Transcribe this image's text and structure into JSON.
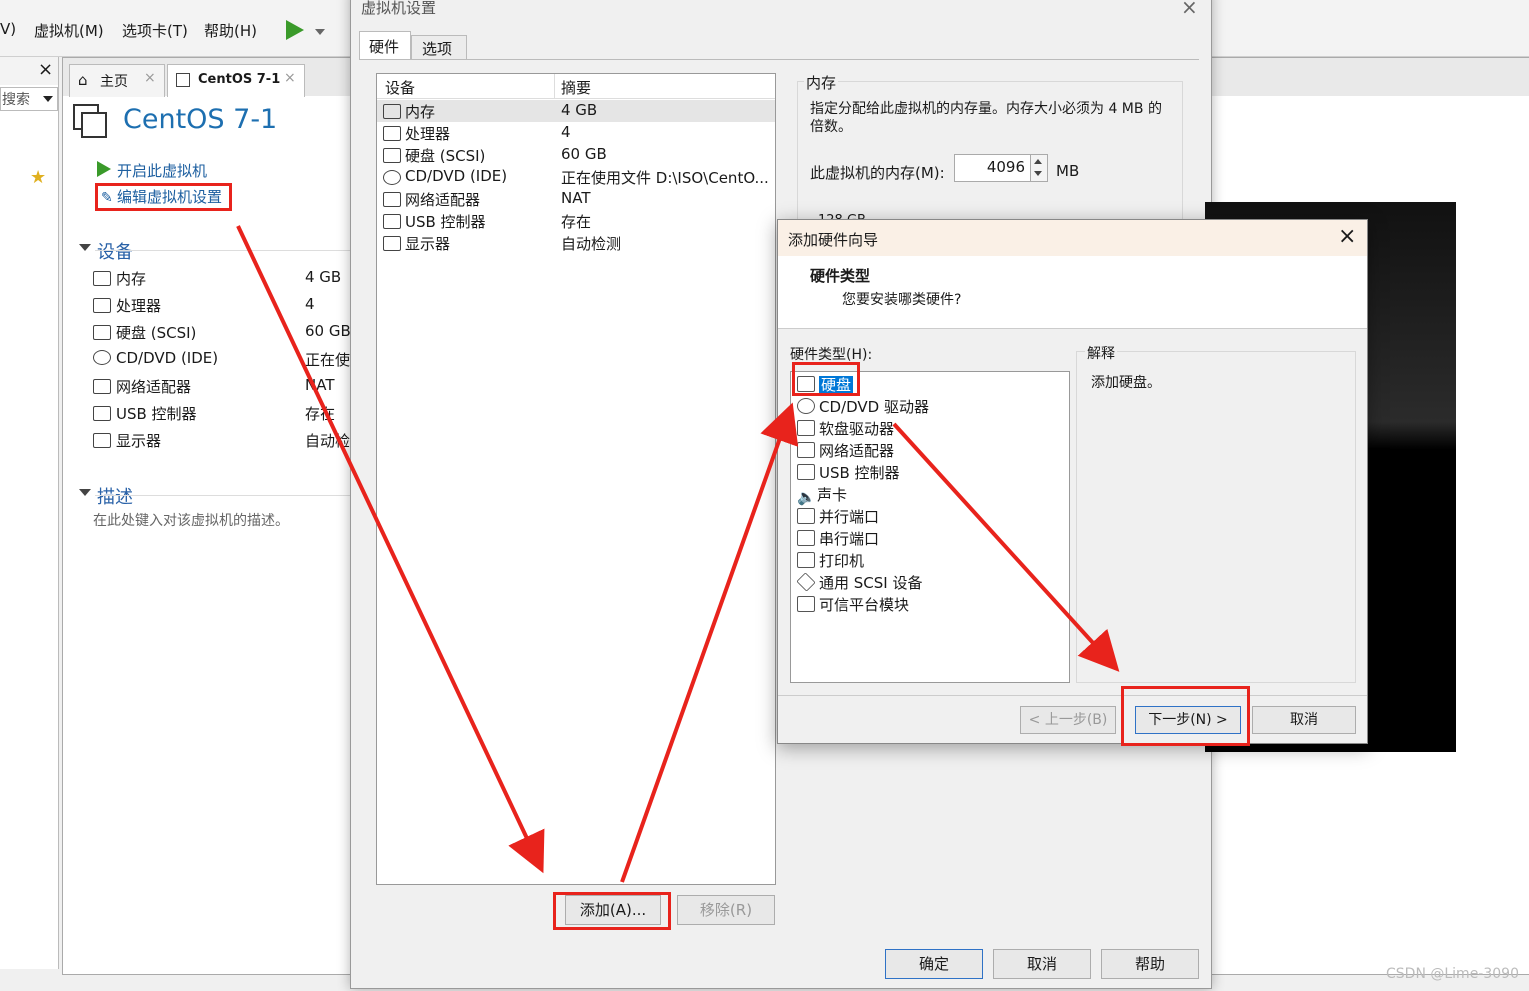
{
  "menubar": {
    "partial_left": "V)",
    "items": [
      "虚拟机(M)",
      "选项卡(T)",
      "帮助(H)"
    ]
  },
  "library": {
    "close": "×",
    "search": "搜索"
  },
  "tabs": [
    {
      "label": "主页"
    },
    {
      "label": "CentOS 7-1"
    }
  ],
  "vm": {
    "title": "CentOS 7-1",
    "actions": [
      "开启此虚拟机",
      "编辑虚拟机设置"
    ],
    "devices_heading": "设备",
    "devices": [
      {
        "name": "内存",
        "value": "4 GB"
      },
      {
        "name": "处理器",
        "value": "4"
      },
      {
        "name": "硬盘 (SCSI)",
        "value": "60 GB"
      },
      {
        "name": "CD/DVD (IDE)",
        "value": "正在使"
      },
      {
        "name": "网络适配器",
        "value": "NAT"
      },
      {
        "name": "USB 控制器",
        "value": "存在"
      },
      {
        "name": "显示器",
        "value": "自动检"
      }
    ],
    "desc_heading": "描述",
    "desc_placeholder": "在此处键入对该虚拟机的描述。"
  },
  "settings": {
    "title": "虚拟机设置",
    "tabs": [
      "硬件",
      "选项"
    ],
    "col_device": "设备",
    "col_summary": "摘要",
    "rows": [
      {
        "name": "内存",
        "summary": "4 GB"
      },
      {
        "name": "处理器",
        "summary": "4"
      },
      {
        "name": "硬盘 (SCSI)",
        "summary": "60 GB"
      },
      {
        "name": "CD/DVD (IDE)",
        "summary": "正在使用文件 D:\\ISO\\CentO..."
      },
      {
        "name": "网络适配器",
        "summary": "NAT"
      },
      {
        "name": "USB 控制器",
        "summary": "存在"
      },
      {
        "name": "显示器",
        "summary": "自动检测"
      }
    ],
    "add_btn": "添加(A)...",
    "remove_btn": "移除(R)",
    "ok_btn": "确定",
    "cancel_btn": "取消",
    "help_btn": "帮助",
    "memory": {
      "group": "内存",
      "desc": "指定分配给此虚拟机的内存量。内存大小必须为 4 MB 的倍数。",
      "label": "此虚拟机的内存(M):",
      "value": "4096",
      "unit": "MB",
      "partial": "128 GB"
    }
  },
  "wizard": {
    "title": "添加硬件向导",
    "heading": "硬件类型",
    "subheading": "您要安装哪类硬件?",
    "list_label": "硬件类型(H):",
    "items": [
      "硬盘",
      "CD/DVD 驱动器",
      "软盘驱动器",
      "网络适配器",
      "USB 控制器",
      "声卡",
      "并行端口",
      "串行端口",
      "打印机",
      "通用 SCSI 设备",
      "可信平台模块"
    ],
    "explain_label": "解释",
    "explain_text": "添加硬盘。",
    "back_btn": "< 上一步(B)",
    "next_btn": "下一步(N) >",
    "cancel_btn": "取消"
  },
  "watermark": "CSDN @Lime-3090",
  "colors": {
    "accent_red": "#e8231c",
    "link_blue": "#1d5fa0",
    "select_blue": "#0078d7"
  }
}
